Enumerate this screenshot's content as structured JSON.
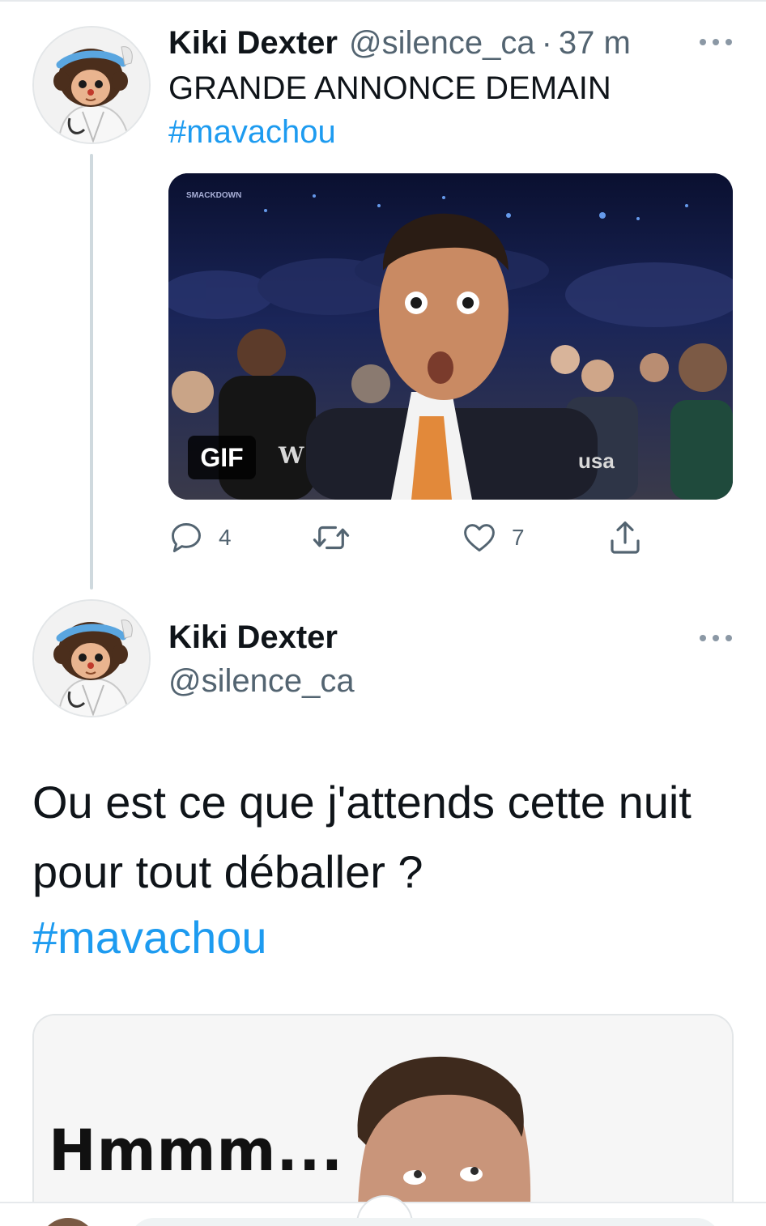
{
  "tweet1": {
    "author_name": "Kiki Dexter",
    "author_handle": "@silence_ca",
    "separator": "·",
    "time": "37 m",
    "text": "GRANDE ANNONCE DEMAIN",
    "hashtag": "#mavachou",
    "media": {
      "badge": "GIF",
      "corner_logo": "SMACKDOWN",
      "network_logo": "usa",
      "brand_logo": "W"
    },
    "actions": {
      "reply_count": "4",
      "retweet_count": "",
      "like_count": "7"
    }
  },
  "tweet2": {
    "author_name": "Kiki Dexter",
    "author_handle": "@silence_ca",
    "text": "Ou est ce que j'attends cette nuit pour tout déballer ?",
    "hashtag": "#mavachou",
    "media": {
      "overlay_text": "Hmmm..."
    }
  },
  "colors": {
    "link": "#1d9bf0",
    "secondary_text": "#536471",
    "primary_text": "#0f1419",
    "thread_line": "#cfd9de"
  },
  "icons": {
    "more": "more-horizontal-icon",
    "reply": "reply-bubble-icon",
    "retweet": "retweet-arrows-icon",
    "like": "heart-outline-icon",
    "share": "share-upload-icon"
  }
}
